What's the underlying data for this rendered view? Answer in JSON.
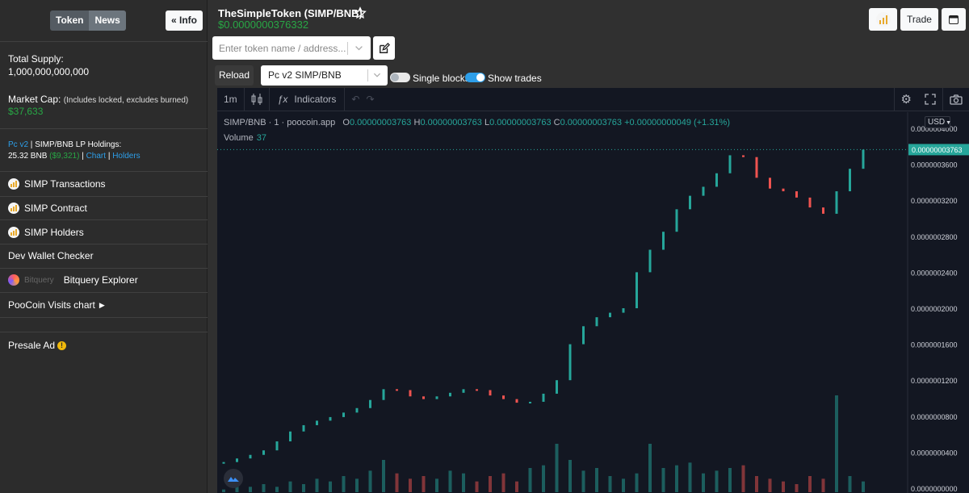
{
  "sidebar": {
    "tabs": [
      {
        "label": "Token"
      },
      {
        "label": "News"
      }
    ],
    "info_button": "Info",
    "total_supply_label": "Total Supply:",
    "total_supply_value": "1,000,000,000,000",
    "market_cap_label": "Market Cap:",
    "market_cap_note": "(Includes locked, excludes burned)",
    "market_cap_value": "$37,633",
    "lp": {
      "version": "Pc v2",
      "label": "SIMP/BNB LP Holdings:",
      "bnb": "25.32 BNB",
      "usd": "($9,321)",
      "chart_link": "Chart",
      "holders_link": "Holders",
      "sep": "|"
    },
    "links": [
      {
        "label": "SIMP Transactions",
        "icon": "poocoin-logo-icon"
      },
      {
        "label": "SIMP Contract",
        "icon": "poocoin-logo-icon"
      },
      {
        "label": "SIMP Holders",
        "icon": "poocoin-logo-icon"
      },
      {
        "label": "Dev Wallet Checker"
      },
      {
        "label": "Bitquery Explorer",
        "icon": "bitquery-logo-icon",
        "prefix": "Bitquery"
      },
      {
        "label": "PooCoin Visits chart"
      }
    ],
    "presale_ad": "Presale Ad"
  },
  "header": {
    "title": "TheSimpleToken (SIMP/BNB)",
    "price": "$0.0000000376332",
    "trade_button": "Trade"
  },
  "search": {
    "placeholder": "Enter token name / address..."
  },
  "controls": {
    "reload": "Reload",
    "pair": "Pc v2 SIMP/BNB",
    "single_blocks": "Single blocks",
    "show_trades": "Show trades",
    "single_blocks_on": false,
    "show_trades_on": true
  },
  "chart": {
    "toolbar": {
      "interval": "1m",
      "indicators": "Indicators"
    },
    "legend": {
      "symbol": "SIMP/BNB",
      "interval": "1",
      "source": "poocoin.app",
      "o_label": "O",
      "o": "0.00000003763",
      "h_label": "H",
      "h": "0.00000003763",
      "l_label": "L",
      "l": "0.00000003763",
      "c_label": "C",
      "c": "0.00000003763",
      "change": "+0.00000000049 (+1.31%)",
      "volume_label": "Volume",
      "volume": "37"
    },
    "currency": "USD",
    "colors": {
      "up": "#26a69a",
      "down": "#ef5350",
      "bg": "#131722"
    }
  },
  "chart_data": {
    "type": "line",
    "title": "SIMP/BNB",
    "ylabel": "",
    "ylim": [
      0,
      4e-08
    ],
    "y_ticks": [
      "0.0000000000",
      "0.0000000400",
      "0.0000000800",
      "0.0000001200",
      "0.0000001600",
      "0.0000002000",
      "0.0000002400",
      "0.0000002800",
      "0.0000003200",
      "0.0000003600",
      "0.0000004000"
    ],
    "last_price_label": "0.00000003763",
    "series": [
      {
        "name": "SIMP/BNB",
        "values": [
          2.9e-09,
          3.3e-09,
          3.7e-09,
          4.2e-09,
          5.2e-09,
          6.3e-09,
          7e-09,
          7.5e-09,
          7.9e-09,
          8.4e-09,
          8.9e-09,
          9.8e-09,
          1.1e-08,
          1.09e-08,
          1.02e-08,
          9.9e-09,
          1.02e-08,
          1.06e-08,
          1.1e-08,
          1.09e-08,
          1.03e-08,
          9.9e-09,
          9.5e-09,
          9.6e-09,
          1.05e-08,
          1.2e-08,
          1.6e-08,
          1.8e-08,
          1.9e-08,
          1.95e-08,
          2e-08,
          2.4e-08,
          2.65e-08,
          2.85e-08,
          3.1e-08,
          3.25e-08,
          3.35e-08,
          3.5e-08,
          3.7e-08,
          3.68e-08,
          3.45e-08,
          3.33e-08,
          3.3e-08,
          3.23e-08,
          3.12e-08,
          3.05e-08,
          3.3e-08,
          3.55e-08,
          3.763e-08
        ]
      },
      {
        "name": "Volume",
        "values": [
          1,
          2,
          2,
          3,
          2,
          4,
          3,
          5,
          4,
          6,
          5,
          8,
          12,
          7,
          5,
          6,
          5,
          8,
          7,
          4,
          6,
          7,
          4,
          9,
          10,
          18,
          12,
          8,
          9,
          6,
          5,
          7,
          18,
          9,
          10,
          11,
          7,
          8,
          9,
          10,
          6,
          5,
          4,
          3,
          6,
          5,
          36,
          6,
          4
        ]
      }
    ]
  }
}
